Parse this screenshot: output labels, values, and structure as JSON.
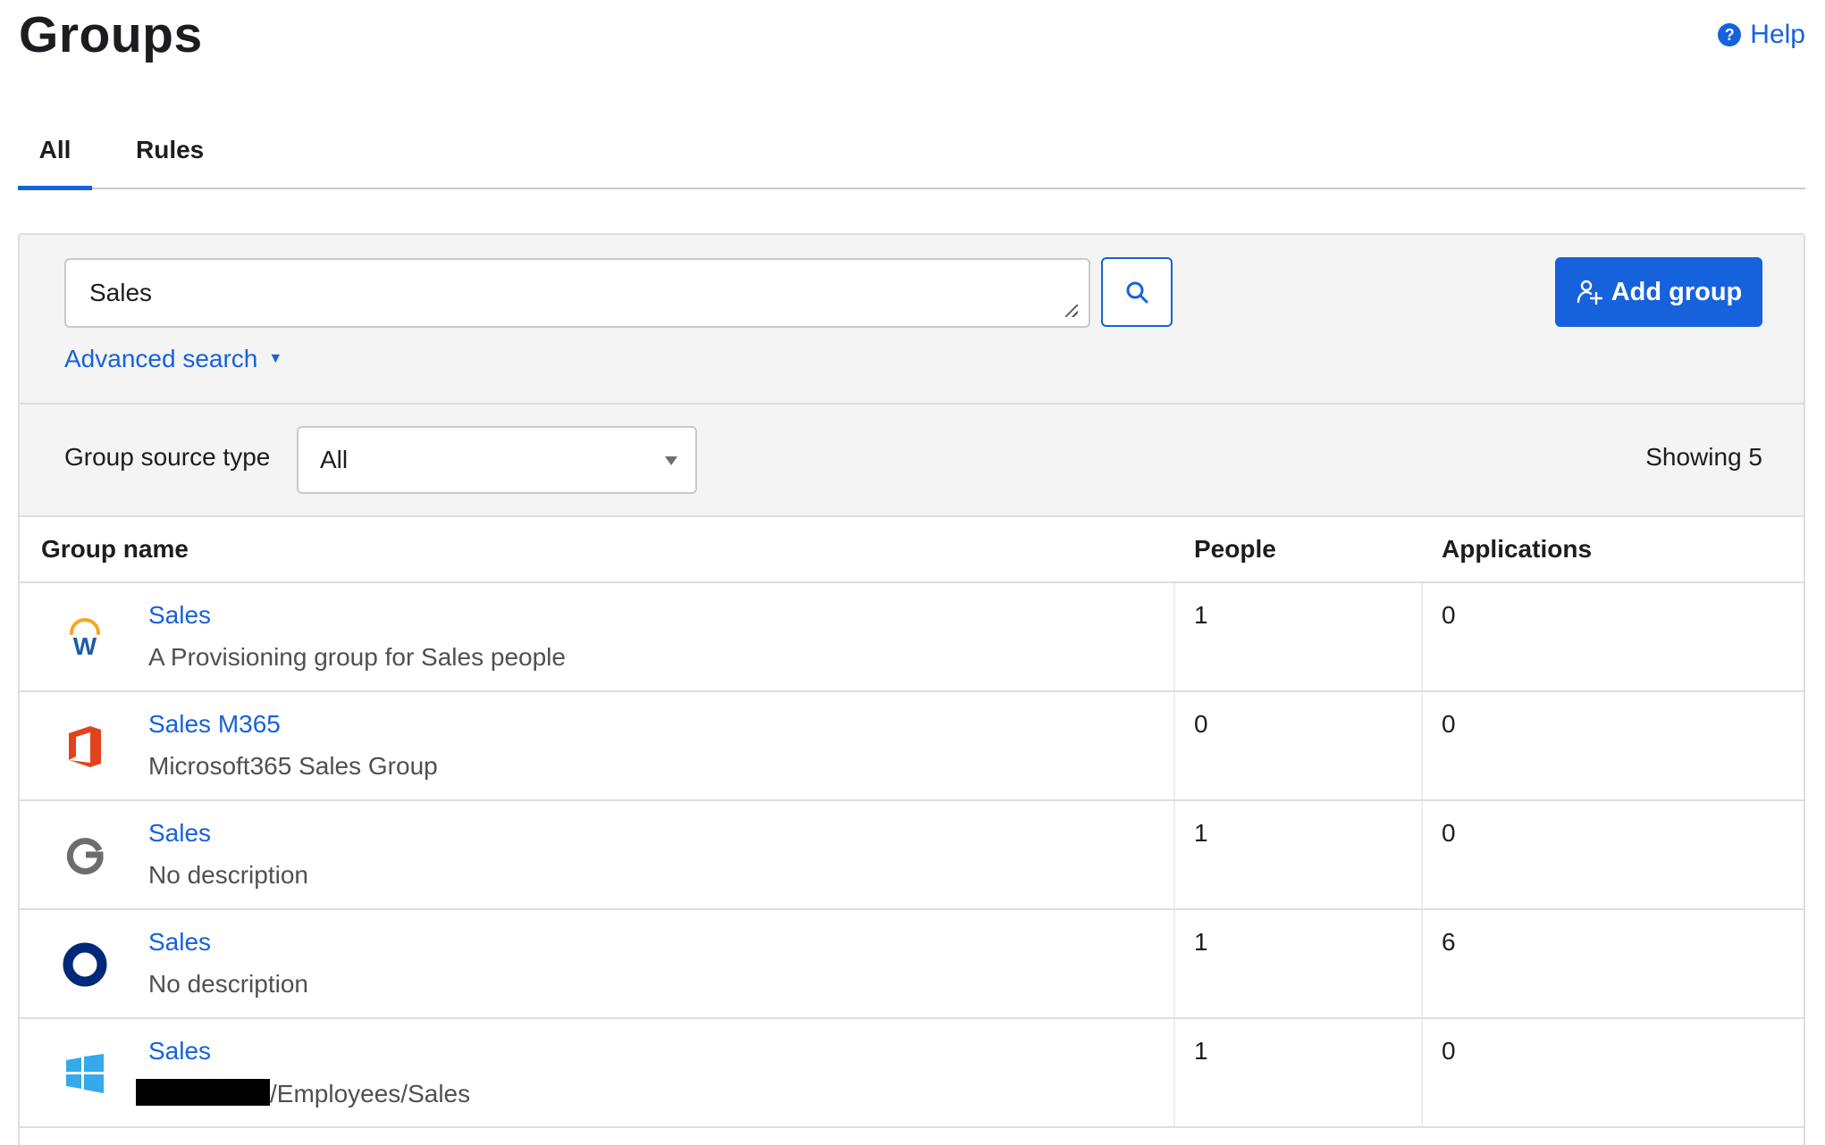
{
  "header": {
    "title": "Groups",
    "help_label": "Help",
    "help_icon": "question-circle-icon"
  },
  "tabs": [
    {
      "label": "All",
      "active": true
    },
    {
      "label": "Rules",
      "active": false
    }
  ],
  "search": {
    "value": "Sales",
    "search_icon": "search-icon",
    "advanced_label": "Advanced search",
    "advanced_caret": "▼"
  },
  "add_group": {
    "label": "Add group",
    "icon": "add-user-icon"
  },
  "filter": {
    "label": "Group source type",
    "selected": "All",
    "showing": "Showing 5"
  },
  "table": {
    "columns": [
      "Group name",
      "People",
      "Applications"
    ],
    "rows": [
      {
        "icon": "workday-icon",
        "name": "Sales",
        "description": "A Provisioning group for Sales people",
        "people": "1",
        "applications": "0"
      },
      {
        "icon": "microsoft-office-icon",
        "name": "Sales M365",
        "description": "Microsoft365 Sales Group",
        "people": "0",
        "applications": "0"
      },
      {
        "icon": "google-icon",
        "name": "Sales",
        "description": "No description",
        "people": "1",
        "applications": "0"
      },
      {
        "icon": "okta-icon",
        "name": "Sales",
        "description": "No description",
        "people": "1",
        "applications": "6"
      },
      {
        "icon": "windows-icon",
        "name": "Sales",
        "description": "/Employees/Sales",
        "people": "1",
        "applications": "0"
      }
    ]
  },
  "colors": {
    "accent": "#1662dd",
    "text": "#1d1d21",
    "muted_text": "#4f4f57",
    "panel_bg": "#f4f4f4",
    "border": "#dedede"
  }
}
